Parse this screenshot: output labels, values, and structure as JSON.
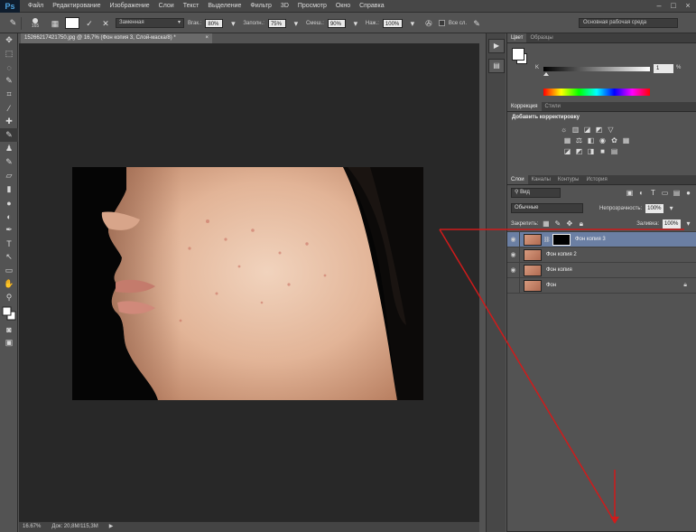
{
  "app": {
    "logo": "Ps"
  },
  "menu": [
    "Файл",
    "Редактирование",
    "Изображение",
    "Слои",
    "Текст",
    "Выделение",
    "Фильтр",
    "3D",
    "Просмотр",
    "Окно",
    "Справка"
  ],
  "options": {
    "brush_size": "165",
    "mode_value": "Заменная",
    "opacity_label": "Вгак.:",
    "opacity_value": "80%",
    "flow_label": "Заполн.:",
    "flow_value": "75%",
    "mix_label": "Смеш.:",
    "mix_value": "90%",
    "flow2_label": "Наж.:",
    "flow2_value": "100%",
    "all_layers_label": "Все сл.",
    "workspace": "Основная рабочая среда"
  },
  "document": {
    "tab_title": "15266217421750.jpg @ 16,7% (Фон копия 3, Слой-маска/8) *",
    "tab_close": "×",
    "zoom": "16.67%",
    "doc_size": "Док: 20,8М/115,3М"
  },
  "color_panel": {
    "tabs": [
      "Цвет",
      "Образцы"
    ],
    "channel": "K",
    "value": "1",
    "unit": "%",
    "slider_level": 0.0
  },
  "adjust_panel": {
    "tabs": [
      "Коррекция",
      "Стили"
    ],
    "title": "Добавить корректировку"
  },
  "layers_panel": {
    "tabs": [
      "Слои",
      "Каналы",
      "Контуры",
      "История"
    ],
    "filter": "Вид",
    "blend_mode": "Обычные",
    "opacity_label": "Непрозрачность:",
    "opacity_value": "100%",
    "lock_label": "Закрепить:",
    "fill_label": "Заливка:",
    "fill_value": "100%",
    "layers": [
      {
        "name": "Фон копия 3",
        "selected": true,
        "mask": true
      },
      {
        "name": "Фон копия 2",
        "selected": false,
        "mask": false
      },
      {
        "name": "Фон копия",
        "selected": false,
        "mask": false
      },
      {
        "name": "Фон",
        "selected": false,
        "mask": false,
        "locked": true
      }
    ]
  }
}
